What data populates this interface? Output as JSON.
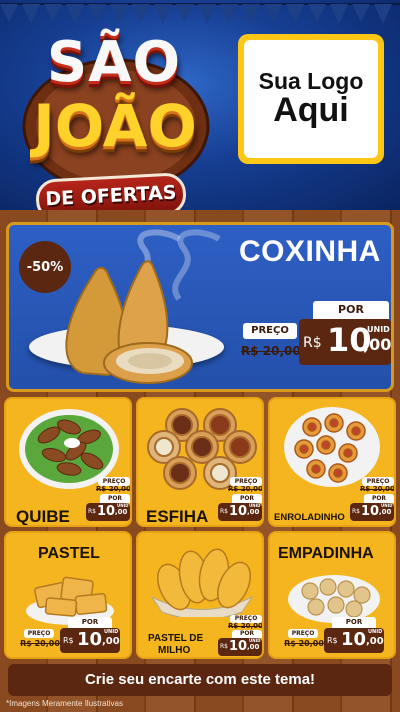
{
  "header": {
    "title_line1": "SÃO",
    "title_line2": "JOÃO",
    "title_line3": "DE OFERTAS",
    "logo_placeholder_line1": "Sua Logo",
    "logo_placeholder_line2": "Aqui"
  },
  "featured": {
    "name": "COXINHA",
    "discount": "-50%",
    "por_label": "POR",
    "preco_label": "PREÇO",
    "old_price": "R$ 20,00",
    "currency": "R$",
    "price_int": "10",
    "price_cents": ",00",
    "unit": "UNID"
  },
  "products": [
    {
      "name": "QUIBE",
      "preco_label": "PREÇO",
      "old_price": "R$ 20,00",
      "por_label": "POR",
      "currency": "R$",
      "price_int": "10",
      "price_cents": ",00",
      "unit": "UNID"
    },
    {
      "name": "ESFIHA",
      "preco_label": "PREÇO",
      "old_price": "R$ 20,00",
      "por_label": "POR",
      "currency": "R$",
      "price_int": "10",
      "price_cents": ",00",
      "unit": "UNID"
    },
    {
      "name": "ENROLADINHO",
      "preco_label": "PREÇO",
      "old_price": "R$ 20,00",
      "por_label": "POR",
      "currency": "R$",
      "price_int": "10",
      "price_cents": ",00",
      "unit": "UNID"
    },
    {
      "name": "PASTEL",
      "preco_label": "PREÇO",
      "old_price": "R$ 20,00",
      "por_label": "POR",
      "currency": "R$",
      "price_int": "10",
      "price_cents": ",00",
      "unit": "UNID"
    },
    {
      "name_line1": "PASTEL DE",
      "name_line2": "MILHO",
      "preco_label": "PREÇO",
      "old_price": "R$ 20,00",
      "por_label": "POR",
      "currency": "R$",
      "price_int": "10",
      "price_cents": ",00",
      "unit": "UNID"
    },
    {
      "name": "EMPADINHA",
      "preco_label": "PREÇO",
      "old_price": "R$ 20,00",
      "por_label": "POR",
      "currency": "R$",
      "price_int": "10",
      "price_cents": ",00",
      "unit": "UNID"
    }
  ],
  "footer": {
    "cta": "Crie seu encarte com este tema!",
    "disclaimer": "*Imagens Meramente Ilustrativas"
  },
  "colors": {
    "header_blue": "#163e92",
    "feature_blue": "#2a58b8",
    "card_yellow": "#f4b51e",
    "price_brown": "#5b2711",
    "wood": "#8a4a20"
  }
}
